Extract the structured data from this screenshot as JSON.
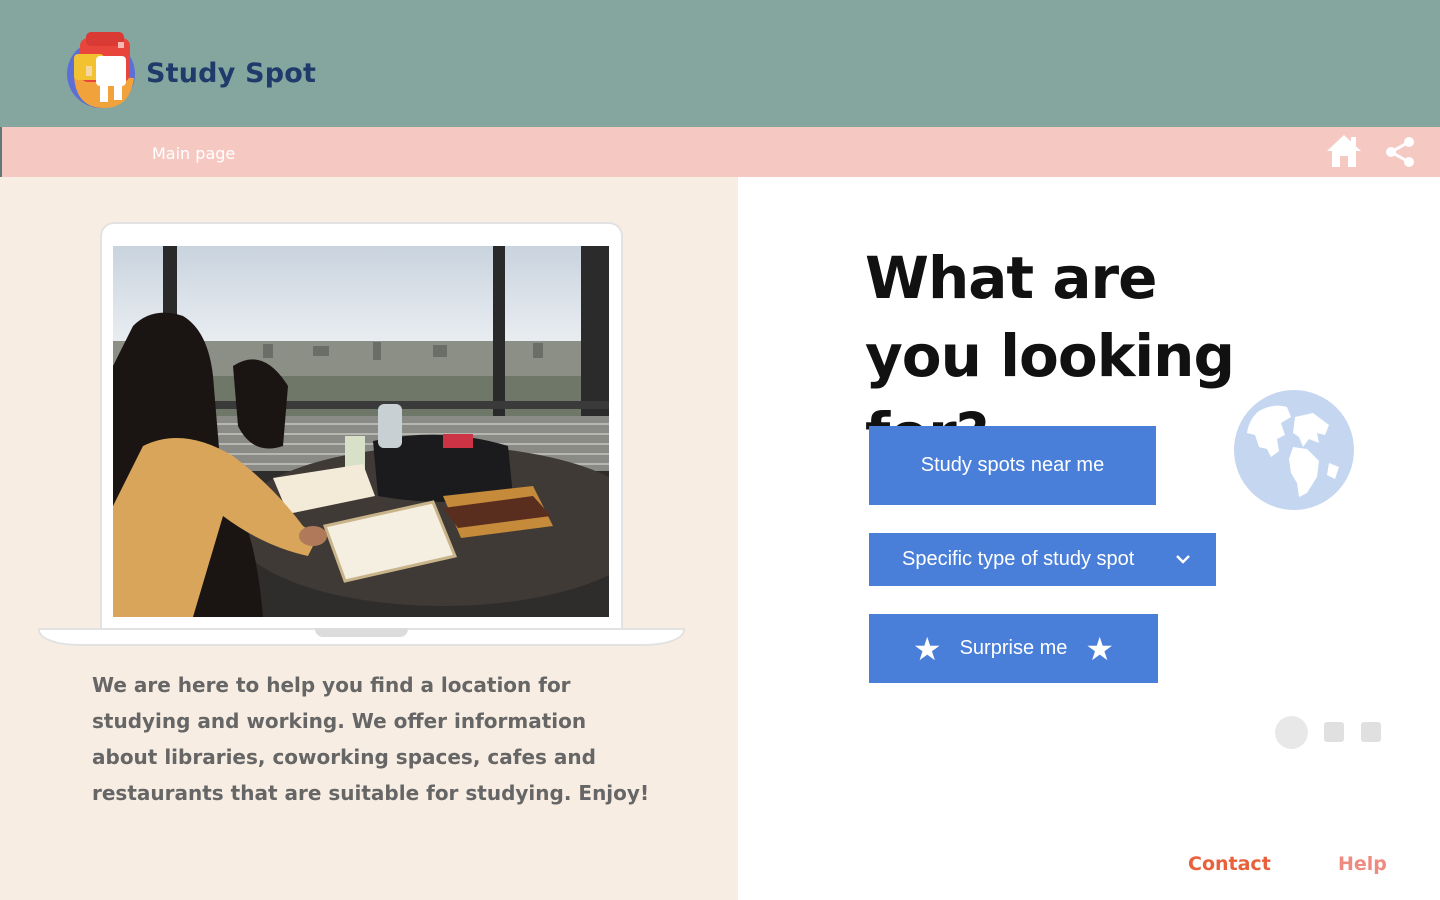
{
  "header": {
    "brand": "Study Spot",
    "logo_icon": "backpack-logo-icon",
    "background_color": "#85a69e",
    "brand_color": "#1f3a6b"
  },
  "navbar": {
    "main_link": "Main page",
    "home_icon": "home-icon",
    "share_icon": "share-icon",
    "background_color": "#f5c9c2"
  },
  "left_panel": {
    "background_color": "#f7ede3",
    "photo": "student-studying-by-window-photo",
    "intro_text": "We are here to help you find a location for studying and working. We offer information about libraries, coworking spaces, cafes and restaurants that are suitable for studying. Enjoy!"
  },
  "main": {
    "headline": "What are you looking for?",
    "globe_icon": "globe-icon",
    "buttons": {
      "near_me": "Study spots near me",
      "specific_type": "Specific type of study spot",
      "surprise": "Surprise me"
    },
    "button_color": "#4a7fd9",
    "star_glyph": "★",
    "chevron_icon": "chevron-down-icon"
  },
  "carousel": {
    "dots": 3,
    "active_index": 0
  },
  "footer": {
    "contact": "Contact",
    "help": "Help",
    "contact_color": "#e8603c",
    "help_color": "#ee8a80"
  }
}
